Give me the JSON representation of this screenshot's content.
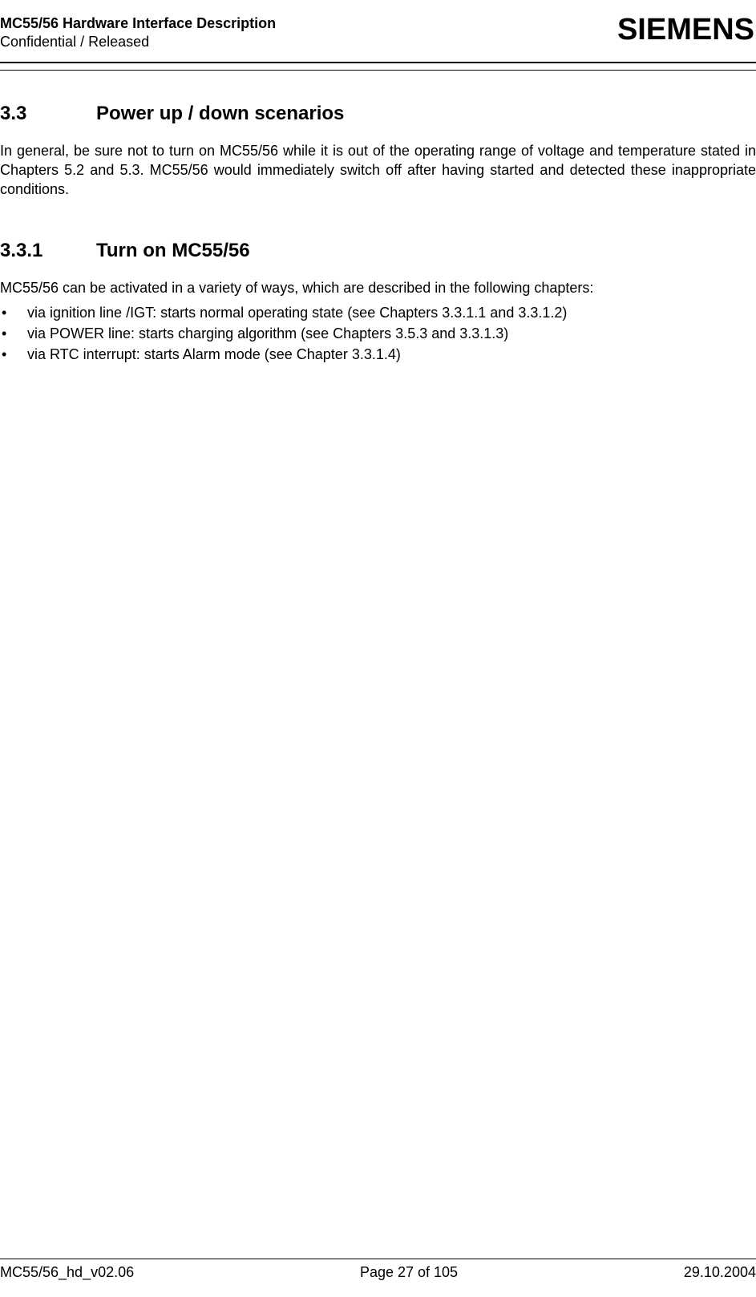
{
  "header": {
    "doc_title": "MC55/56 Hardware Interface Description",
    "doc_status": "Confidential / Released",
    "brand": "SIEMENS"
  },
  "section": {
    "number": "3.3",
    "title": "Power up / down scenarios",
    "intro": "In general, be sure not to turn on MC55/56 while it is out of the operating range of voltage and temperature stated in Chapters 5.2 and 5.3. MC55/56 would immediately switch off after having started and detected these inappropriate conditions."
  },
  "subsection": {
    "number": "3.3.1",
    "title": "Turn on MC55/56",
    "intro": "MC55/56 can be activated in a variety of ways, which are described in the following chapters:",
    "items": [
      "via ignition line /IGT: starts normal operating state (see Chapters 3.3.1.1 and 3.3.1.2)",
      "via POWER line: starts charging algorithm (see Chapters 3.5.3 and 3.3.1.3)",
      "via RTC interrupt: starts Alarm mode (see Chapter 3.3.1.4)"
    ]
  },
  "footer": {
    "left": "MC55/56_hd_v02.06",
    "center": "Page 27 of 105",
    "right": "29.10.2004"
  },
  "bullet_char": "•"
}
